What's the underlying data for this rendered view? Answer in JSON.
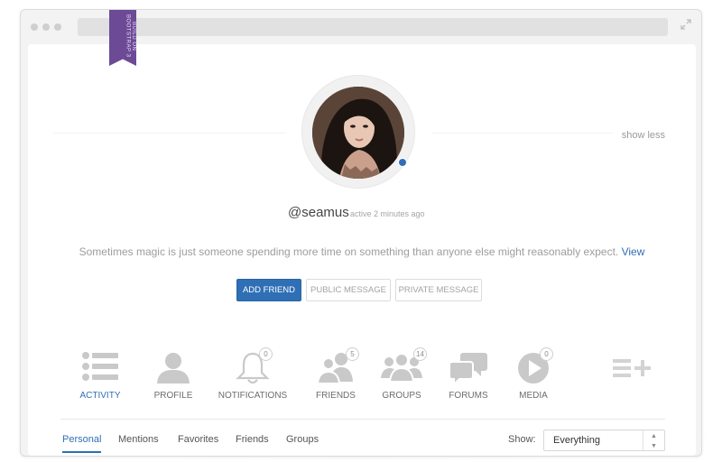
{
  "ribbon": {
    "line1": "BUILD ON",
    "line2": "BOOTSTRAP 3"
  },
  "profile": {
    "toggle_label": "show less",
    "username": "@seamus",
    "last_active": "active 2 minutes ago",
    "bio": "Sometimes magic is just someone spending more time on something than anyone else might reasonably expect.",
    "bio_link": "View"
  },
  "actions": {
    "add_friend": "ADD FRIEND",
    "public_message": "PUBLIC MESSAGE",
    "private_message": "PRIVATE MESSAGE"
  },
  "nav": [
    {
      "label": "ACTIVITY",
      "icon": "activity-list-icon",
      "badge": ""
    },
    {
      "label": "PROFILE",
      "icon": "person-icon",
      "badge": ""
    },
    {
      "label": "NOTIFICATIONS",
      "icon": "bell-icon",
      "badge": "0"
    },
    {
      "label": "FRIENDS",
      "icon": "friends-icon",
      "badge": "5"
    },
    {
      "label": "GROUPS",
      "icon": "group-icon",
      "badge": "14"
    },
    {
      "label": "FORUMS",
      "icon": "speech-bubbles-icon",
      "badge": ""
    },
    {
      "label": "MEDIA",
      "icon": "play-circle-icon",
      "badge": "0"
    }
  ],
  "more_icon": "list-add-icon",
  "subtabs": [
    "Personal",
    "Mentions",
    "Favorites",
    "Friends",
    "Groups"
  ],
  "filter": {
    "label": "Show:",
    "value": "Everything"
  },
  "colors": {
    "accent": "#2f6fb5",
    "ribbon": "#6c4a96",
    "icon_gray": "#c9c9c9"
  }
}
